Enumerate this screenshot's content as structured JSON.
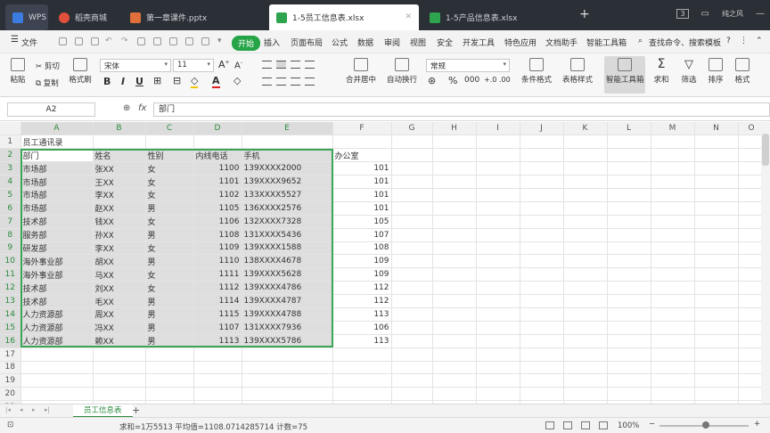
{
  "titlebar": {
    "tabs": [
      {
        "label": "WPS",
        "color": "#3b7ce0"
      },
      {
        "label": "稻壳商城",
        "color": "#e0503b"
      },
      {
        "label": "第一章课件.pptx",
        "color": "#e0703b"
      },
      {
        "label": "1-5员工信息表.xlsx",
        "color": "#2ea44f"
      },
      {
        "label": "1-5产品信息表.xlsx",
        "color": "#2ea44f"
      }
    ],
    "badge": "3",
    "user": "纯之风"
  },
  "menubar": {
    "file": "文件",
    "items": [
      "开始",
      "插入",
      "页面布局",
      "公式",
      "数据",
      "审阅",
      "视图",
      "安全",
      "开发工具",
      "特色应用",
      "文档助手",
      "智能工具箱"
    ],
    "search": "查找命令、搜索模板"
  },
  "ribbon": {
    "paste": "粘贴",
    "cut": "剪切",
    "copy": "复制",
    "format_painter": "格式刷",
    "font_name": "宋体",
    "font_size": "11",
    "merge_center": "合并居中",
    "wrap_text": "自动换行",
    "number_format": "常规",
    "conditional_format": "条件格式",
    "table_style": "表格样式",
    "smart_toolbox": "智能工具箱",
    "sum": "求和",
    "filter": "筛选",
    "sort": "排序",
    "format": "格式"
  },
  "formulabar": {
    "cell_ref": "A2",
    "fx": "fx",
    "content": "部门"
  },
  "sheet": {
    "columns": [
      "A",
      "B",
      "C",
      "D",
      "E",
      "F",
      "G",
      "H",
      "I",
      "J",
      "K",
      "L",
      "M",
      "N",
      "O"
    ],
    "rows": [
      [
        "员工通讯录",
        "",
        "",
        "",
        "",
        ""
      ],
      [
        "部门",
        "姓名",
        "性别",
        "内线电话",
        "手机",
        "办公室"
      ],
      [
        "市场部",
        "张XX",
        "女",
        "1100",
        "139XXXX2000",
        "101"
      ],
      [
        "市场部",
        "王XX",
        "女",
        "1101",
        "139XXXX9652",
        "101"
      ],
      [
        "市场部",
        "李XX",
        "女",
        "1102",
        "133XXXX5527",
        "101"
      ],
      [
        "市场部",
        "赵XX",
        "男",
        "1105",
        "136XXXX2576",
        "101"
      ],
      [
        "技术部",
        "钱XX",
        "女",
        "1106",
        "132XXXX7328",
        "105"
      ],
      [
        "服务部",
        "孙XX",
        "男",
        "1108",
        "131XXXX5436",
        "107"
      ],
      [
        "研发部",
        "李XX",
        "女",
        "1109",
        "139XXXX1588",
        "108"
      ],
      [
        "海外事业部",
        "胡XX",
        "男",
        "1110",
        "138XXXX4678",
        "109"
      ],
      [
        "海外事业部",
        "马XX",
        "女",
        "1111",
        "139XXXX5628",
        "109"
      ],
      [
        "技术部",
        "刘XX",
        "女",
        "1112",
        "139XXXX4786",
        "112"
      ],
      [
        "技术部",
        "毛XX",
        "男",
        "1114",
        "139XXXX4787",
        "112"
      ],
      [
        "人力资源部",
        "周XX",
        "男",
        "1115",
        "139XXXX4788",
        "113"
      ],
      [
        "人力资源部",
        "冯XX",
        "男",
        "1107",
        "131XXXX7936",
        "106"
      ],
      [
        "人力资源部",
        "赖XX",
        "男",
        "1113",
        "139XXXX5786",
        "113"
      ]
    ],
    "total_rows": 21
  },
  "sheettabs": {
    "active": "员工信息表",
    "add": "+"
  },
  "statusbar": {
    "stats": "求和=1万5513  平均值=1108.0714285714  计数=75",
    "zoom": "100%"
  },
  "accent": "#2ea44f"
}
